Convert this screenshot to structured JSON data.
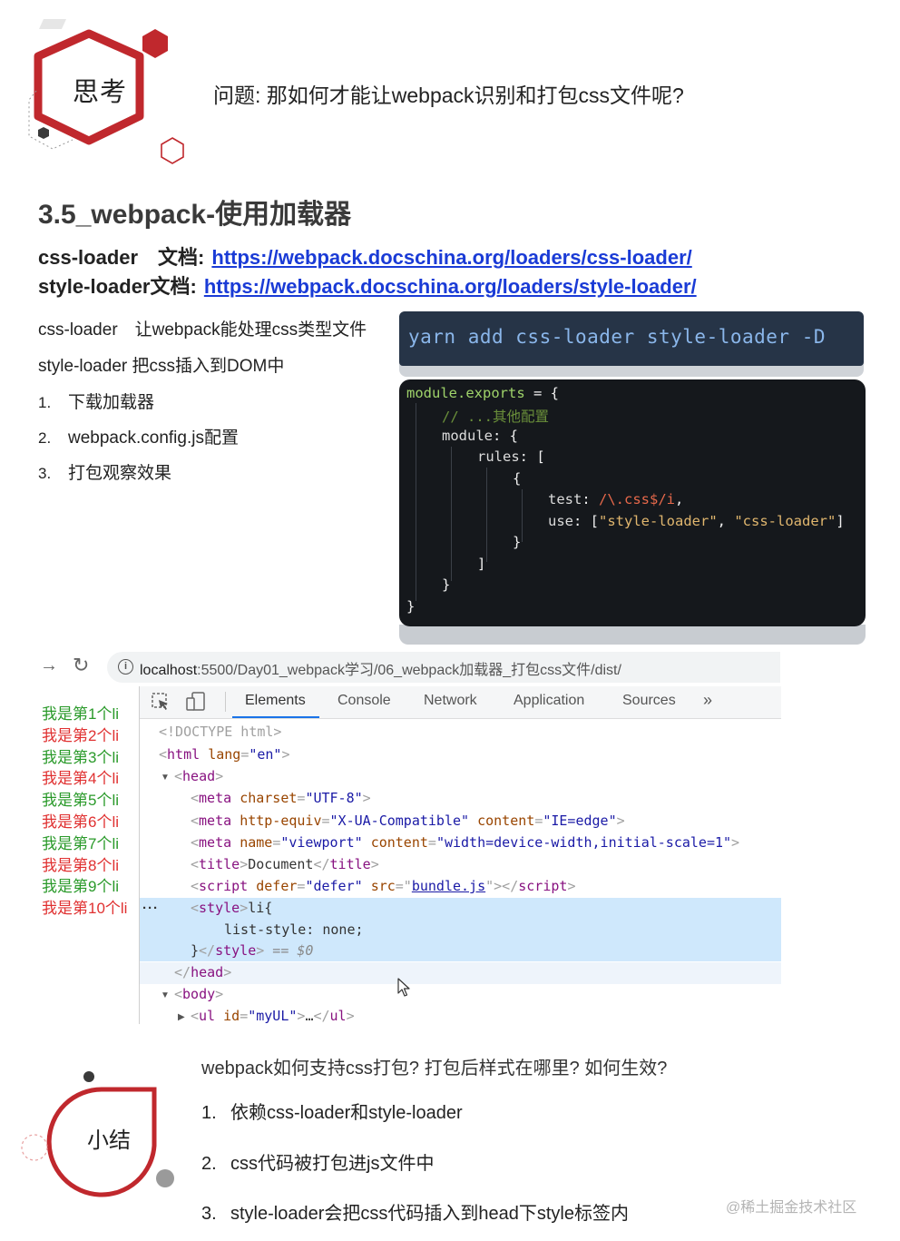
{
  "think": {
    "badge": "思考",
    "question": "问题: 那如何才能让webpack识别和打包css文件呢?"
  },
  "section": {
    "title": "3.5_webpack-使用加载器",
    "docs": [
      {
        "label": "css-loader　文档:",
        "url": "https://webpack.docschina.org/loaders/css-loader/"
      },
      {
        "label": "style-loader文档:",
        "url": "https://webpack.docschina.org/loaders/style-loader/"
      }
    ],
    "descs": [
      "css-loader　让webpack能处理css类型文件",
      "style-loader 把css插入到DOM中"
    ],
    "steps": [
      {
        "num": "1.",
        "text": "下载加载器"
      },
      {
        "num": "2.",
        "text": "webpack.config.js配置"
      },
      {
        "num": "3.",
        "text": "打包观察效果"
      }
    ]
  },
  "install_cmd": "yarn add css-loader style-loader -D",
  "code": {
    "l1_a": "module.exports",
    "l1_b": " = {",
    "l2": "// ...其他配置",
    "l3_a": "module",
    "l3_b": ": {",
    "l4_a": "rules",
    "l4_b": ": [",
    "l5": "{",
    "l6_a": "test",
    "l6_b": ": ",
    "l6_c": "/\\.css$/i",
    "l6_d": ",",
    "l7_a": "use",
    "l7_b": ": [",
    "l7_c": "\"style-loader\"",
    "l7_d": ", ",
    "l7_e": "\"css-loader\"",
    "l7_f": "]",
    "l8": "}",
    "l9": "]",
    "l10": "}",
    "l11": "}"
  },
  "browser": {
    "back_icon": "→",
    "reload_icon": "↻",
    "url_host": "localhost",
    "url_path": ":5500/Day01_webpack学习/06_webpack加载器_打包css文件/dist/"
  },
  "page_items": [
    {
      "text": "我是第1个li",
      "color": "#2a9a2a"
    },
    {
      "text": "我是第2个li",
      "color": "#e03131"
    },
    {
      "text": "我是第3个li",
      "color": "#2a9a2a"
    },
    {
      "text": "我是第4个li",
      "color": "#e03131"
    },
    {
      "text": "我是第5个li",
      "color": "#2a9a2a"
    },
    {
      "text": "我是第6个li",
      "color": "#e03131"
    },
    {
      "text": "我是第7个li",
      "color": "#2a9a2a"
    },
    {
      "text": "我是第8个li",
      "color": "#e03131"
    },
    {
      "text": "我是第9个li",
      "color": "#2a9a2a"
    },
    {
      "text": "我是第10个li",
      "color": "#e03131"
    }
  ],
  "devtools": {
    "tabs": [
      "Elements",
      "Console",
      "Network",
      "Application",
      "Sources",
      "»"
    ],
    "active_tab": "Elements",
    "dom": {
      "doctype": "<!DOCTYPE html>",
      "html_tag": "html",
      "lang_attr": "lang",
      "lang_val": "\"en\"",
      "head": "head",
      "meta": "meta",
      "charset_attr": "charset",
      "charset_val": "\"UTF-8\"",
      "httpequiv_attr": "http-equiv",
      "httpequiv_val": "\"X-UA-Compatible\"",
      "content_attr": "content",
      "ie_val": "\"IE=edge\"",
      "name_attr": "name",
      "viewport_val": "\"viewport\"",
      "viewport_content_val": "\"width=device-width,initial-scale=1\"",
      "title_tag": "title",
      "title_text": "Document",
      "script_tag": "script",
      "defer_attr": "defer",
      "defer_val": "\"defer\"",
      "src_attr": "src",
      "src_val": "bundle.js",
      "style_tag": "style",
      "style_l1": "li{",
      "style_l2": "list-style: none;",
      "style_l3": "}",
      "eq": " == $0",
      "body": "body",
      "ul_tag": "ul",
      "id_attr": "id",
      "id_val": "\"myUL\"",
      "ul_inner": "…"
    }
  },
  "summary": {
    "badge": "小结",
    "question": "webpack如何支持css打包? 打包后样式在哪里? 如何生效?",
    "items": [
      {
        "num": "1.",
        "text": "依赖css-loader和style-loader"
      },
      {
        "num": "2.",
        "text": "css代码被打包进js文件中"
      },
      {
        "num": "3.",
        "text": "style-loader会把css代码插入到head下style标签内"
      }
    ]
  },
  "watermark": "@稀土掘金技术社区",
  "colors": {
    "accent_red": "#c0282d",
    "link_blue": "#1a3bd6",
    "code_bg": "#15181c",
    "cmd_bg": "#263447"
  }
}
